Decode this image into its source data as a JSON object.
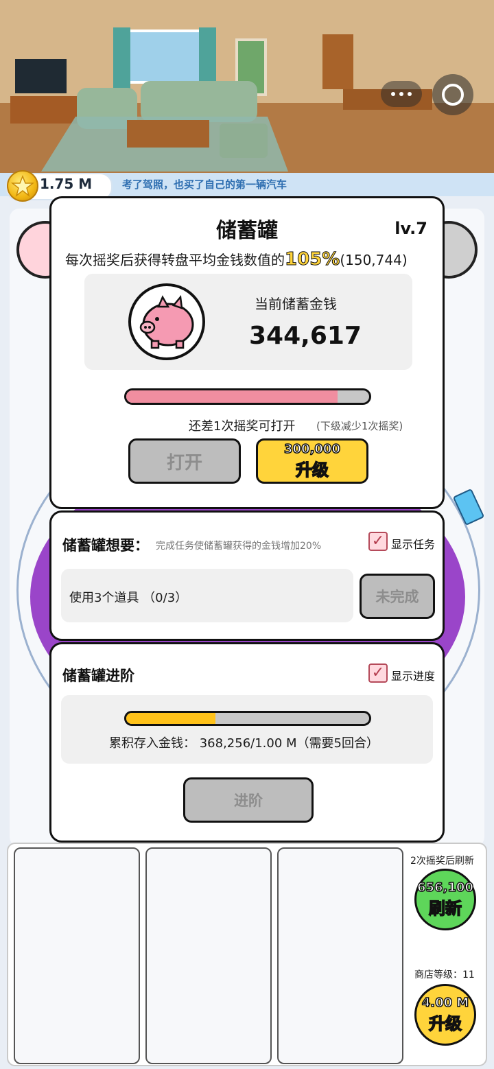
{
  "header": {
    "coin_amount": "1.75 M",
    "story": "考了驾照，也买了自己的第一辆汽车"
  },
  "piggy": {
    "title": "储蓄罐",
    "level": "lv.7",
    "desc_prefix": "每次摇奖后获得转盘平均金钱数值的",
    "desc_percent": "105%",
    "desc_value": "(150,744)",
    "current_label": "当前储蓄金钱",
    "current_amount": "344,617",
    "progress": 0.87,
    "remain_text": "还差1次摇奖可打开",
    "remain_note": "(下级减少1次摇奖)",
    "open_label": "打开",
    "upgrade_cost": "300,000",
    "upgrade_label": "升级"
  },
  "wants": {
    "title": "储蓄罐想要：",
    "subtitle": "完成任务使储蓄罐获得的金钱增加20%",
    "show_label": "显示任务",
    "task_text": "使用3个道具 （0/3）",
    "status_label": "未完成"
  },
  "advance": {
    "title": "储蓄罐进阶",
    "show_label": "显示进度",
    "progress": 0.368,
    "accum_text": "累积存入金钱： 368,256/1.00 M（需要5回合）",
    "advance_label": "进阶"
  },
  "shop": {
    "refresh_note": "2次摇奖后刷新",
    "refresh_cost": "656,100",
    "refresh_label": "刷新",
    "level_text": "商店等级：11",
    "upgrade_cost": "4.00 M",
    "upgrade_label": "升级"
  },
  "colors": {
    "piggy_bar": "#f08ea0",
    "advance_bar": "#ffc21a",
    "refresh_btn": "#5ed65a",
    "upgrade_btn": "#ffd43b",
    "wheel_purple": "#9a45c9"
  }
}
